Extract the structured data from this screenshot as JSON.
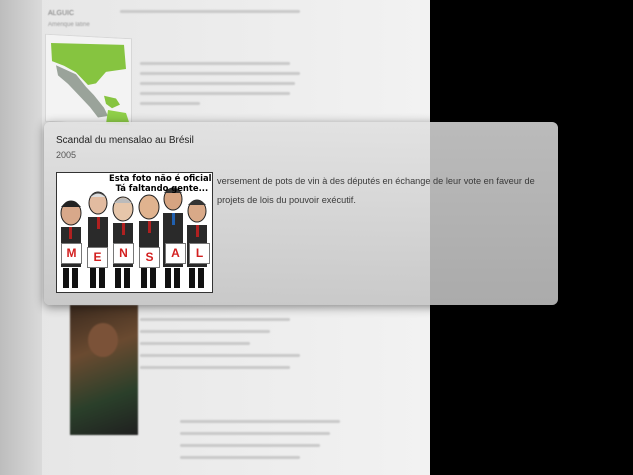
{
  "background_page": {
    "header": "ALGUIC",
    "subheader": "Amérique latine"
  },
  "popup": {
    "title": "Scandal du mensalao au Brésil",
    "year": "2005",
    "description": "versement de pots de vin à des députés en échange de leur vote en faveur de projets de lois du pouvoir exécutif.",
    "image": {
      "caption": "Esta foto não é oficial.\nTá faltando gente...",
      "letters": [
        "M",
        "E",
        "N",
        "S",
        "A",
        "L"
      ]
    }
  },
  "colors": {
    "map_green": "#86c440",
    "sign_red": "#d32020",
    "background_dark": "#000000"
  }
}
